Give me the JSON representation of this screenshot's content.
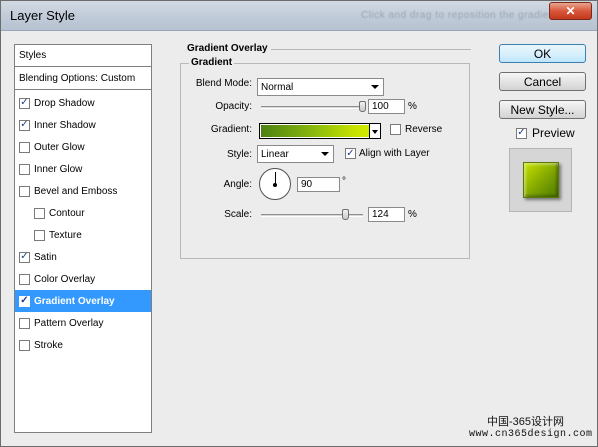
{
  "window": {
    "title": "Layer Style",
    "title_hint": "Click and drag to reposition the gradient",
    "close_label": "✕"
  },
  "stylelist": {
    "header": "Styles",
    "blending": "Blending Options: Custom",
    "items": [
      {
        "label": "Drop Shadow",
        "checked": true,
        "indent": false,
        "selected": false
      },
      {
        "label": "Inner Shadow",
        "checked": true,
        "indent": false,
        "selected": false
      },
      {
        "label": "Outer Glow",
        "checked": false,
        "indent": false,
        "selected": false
      },
      {
        "label": "Inner Glow",
        "checked": false,
        "indent": false,
        "selected": false
      },
      {
        "label": "Bevel and Emboss",
        "checked": false,
        "indent": false,
        "selected": false
      },
      {
        "label": "Contour",
        "checked": false,
        "indent": true,
        "selected": false
      },
      {
        "label": "Texture",
        "checked": false,
        "indent": true,
        "selected": false
      },
      {
        "label": "Satin",
        "checked": true,
        "indent": false,
        "selected": false
      },
      {
        "label": "Color Overlay",
        "checked": false,
        "indent": false,
        "selected": false
      },
      {
        "label": "Gradient Overlay",
        "checked": true,
        "indent": false,
        "selected": true
      },
      {
        "label": "Pattern Overlay",
        "checked": false,
        "indent": false,
        "selected": false
      },
      {
        "label": "Stroke",
        "checked": false,
        "indent": false,
        "selected": false
      }
    ]
  },
  "buttons": {
    "ok": "OK",
    "cancel": "Cancel",
    "new_style": "New Style...",
    "preview_label": "Preview",
    "preview_checked": true
  },
  "panel": {
    "section_title": "Gradient Overlay",
    "group_title": "Gradient",
    "blend_mode_label": "Blend Mode:",
    "blend_mode_value": "Normal",
    "opacity_label": "Opacity:",
    "opacity_value": "100",
    "opacity_unit": "%",
    "opacity_fraction": 1.0,
    "gradient_label": "Gradient:",
    "reverse_label": "Reverse",
    "reverse_checked": false,
    "style_label": "Style:",
    "style_value": "Linear",
    "align_label": "Align with Layer",
    "align_checked": true,
    "angle_label": "Angle:",
    "angle_value": "90",
    "angle_unit": "°",
    "scale_label": "Scale:",
    "scale_value": "124",
    "scale_unit": "%",
    "scale_fraction": 0.83
  },
  "colors": {
    "gradient_start": "#4c7f12",
    "gradient_end": "#dbf000",
    "selection": "#3399ff"
  },
  "watermark": {
    "line1": "中国-365设计网",
    "line2": "www.cn365design.com"
  }
}
